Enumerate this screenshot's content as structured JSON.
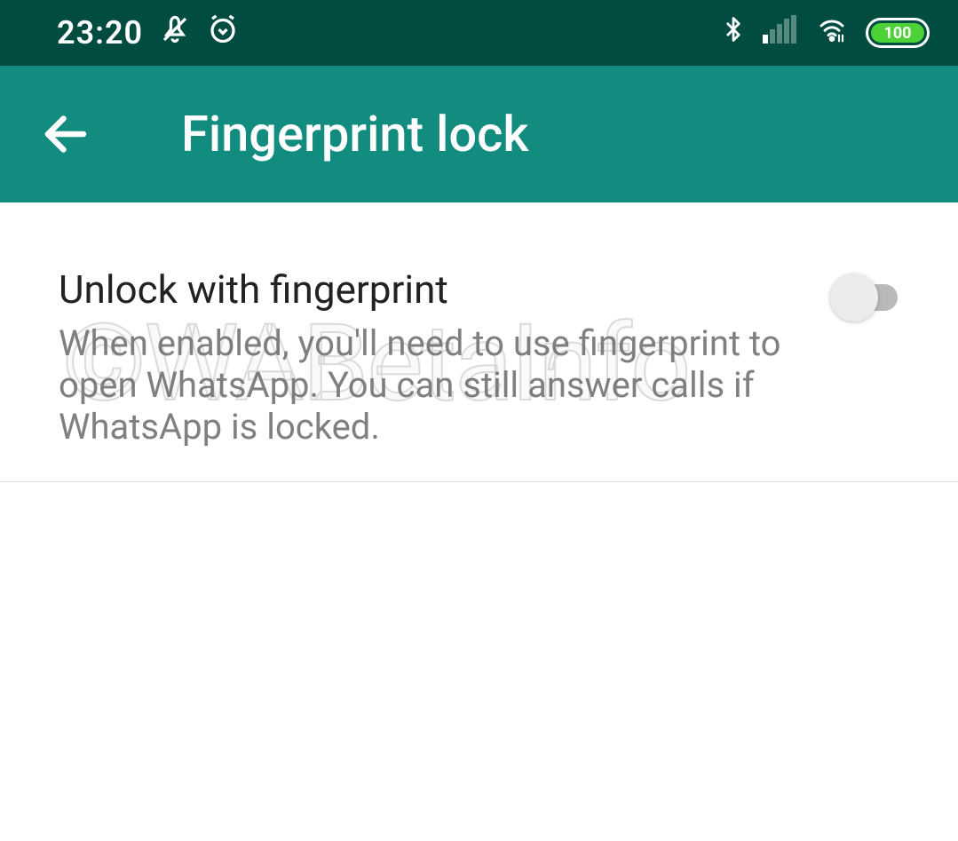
{
  "status": {
    "time": "23:20",
    "battery": "100"
  },
  "header": {
    "title": "Fingerprint lock"
  },
  "setting": {
    "title": "Unlock with fingerprint",
    "description": "When enabled, you'll need to use fingerprint to open WhatsApp. You can still answer calls if WhatsApp is locked.",
    "enabled": false
  },
  "watermark": "©WABetaInfo"
}
